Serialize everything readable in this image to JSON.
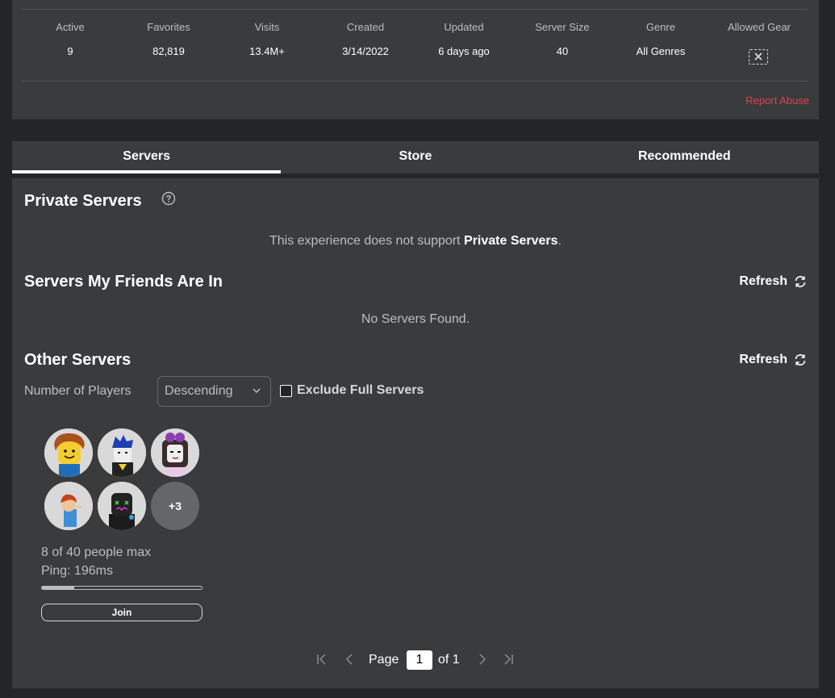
{
  "stats": [
    {
      "label": "Active",
      "value": "9"
    },
    {
      "label": "Favorites",
      "value": "82,819"
    },
    {
      "label": "Visits",
      "value": "13.4M+"
    },
    {
      "label": "Created",
      "value": "3/14/2022"
    },
    {
      "label": "Updated",
      "value": "6 days ago"
    },
    {
      "label": "Server Size",
      "value": "40"
    },
    {
      "label": "Genre",
      "value": "All Genres"
    },
    {
      "label": "Allowed Gear",
      "value": ""
    }
  ],
  "allowed_gear_icon": "no-gear-icon",
  "report_abuse": "Report Abuse",
  "tabs": [
    {
      "label": "Servers",
      "active": true
    },
    {
      "label": "Store",
      "active": false
    },
    {
      "label": "Recommended",
      "active": false
    }
  ],
  "private_servers": {
    "title": "Private Servers",
    "message_prefix": "This experience does not support ",
    "message_bold": "Private Servers",
    "message_suffix": "."
  },
  "friends_servers": {
    "title": "Servers My Friends Are In",
    "refresh_label": "Refresh",
    "empty_message": "No Servers Found."
  },
  "other_servers": {
    "title": "Other Servers",
    "refresh_label": "Refresh",
    "sort_label": "Number of Players",
    "sort_value": "Descending",
    "exclude_full_label": "Exclude Full Servers",
    "exclude_full_checked": false
  },
  "server": {
    "extra_players": "+3",
    "capacity_text": "8 of 40 people max",
    "ping_text": "Ping: 196ms",
    "fill_fraction": 0.2,
    "join_label": "Join"
  },
  "pagination": {
    "page_label": "Page",
    "current_page": "1",
    "of_label": "of 1"
  },
  "colors": {
    "background": "#232527",
    "panel": "#393b3d",
    "report": "#e2414f"
  }
}
